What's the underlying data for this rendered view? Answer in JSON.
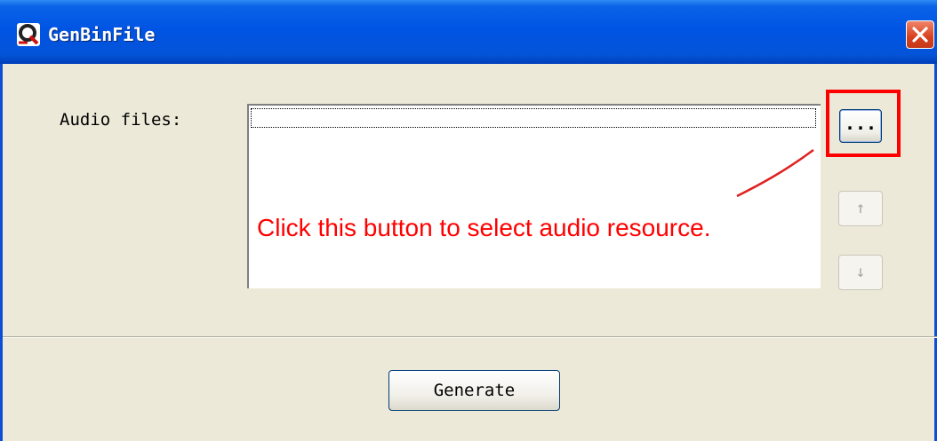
{
  "window": {
    "title": "GenBinFile"
  },
  "form": {
    "audio_label": "Audio files:",
    "browse_label": "...",
    "up_label": "↑",
    "down_label": "↓",
    "generate_label": "Generate"
  },
  "annotation": {
    "text": "Click this button to select audio resource.",
    "color": "#ff0000"
  },
  "icons": {
    "app": "app-logo-icon",
    "close": "close-icon"
  }
}
